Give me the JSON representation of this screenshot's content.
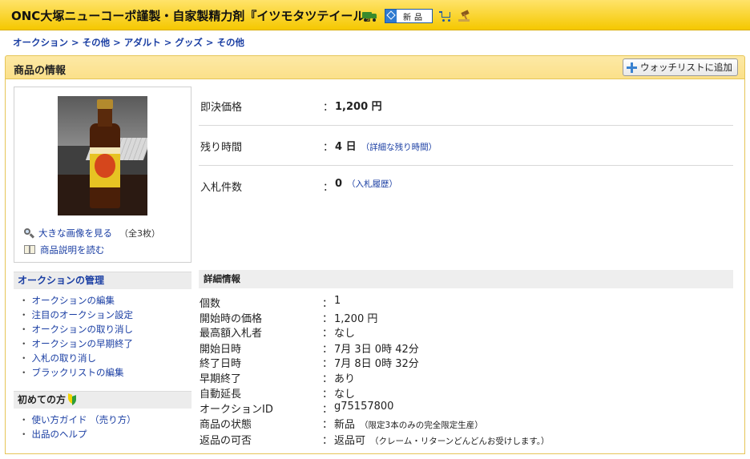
{
  "header": {
    "title": "ONC大塚ニューコーポ謹製・自家製精力剤『イツモタツテイール』",
    "new_badge": "新品"
  },
  "breadcrumb": [
    "オークション",
    "その他",
    "アダルト",
    "グッズ",
    "その他"
  ],
  "section": {
    "title": "商品の情報",
    "watch_button": "ウォッチリストに追加"
  },
  "image_box": {
    "view_large": "大きな画像を見る",
    "count": "（全3枚）",
    "read_description": "商品説明を読む"
  },
  "price_table": {
    "buyout_label": "即決価格",
    "buyout_value": "1,200 円",
    "remaining_label": "残り時間",
    "remaining_value": "4 日",
    "remaining_detail": "（詳細な残り時間）",
    "bids_label": "入札件数",
    "bids_value": "0",
    "bids_history": "（入札履歴）"
  },
  "auction_menu": {
    "title": "オークションの管理",
    "items": [
      "オークションの編集",
      "注目のオークション設定",
      "オークションの取り消し",
      "オークションの早期終了",
      "入札の取り消し",
      "ブラックリストの編集"
    ]
  },
  "beginner_menu": {
    "title": "初めての方",
    "items": [
      "使い方ガイド （売り方）",
      "出品のヘルプ"
    ]
  },
  "details": {
    "title": "詳細情報",
    "rows": [
      {
        "label": "個数",
        "value": "1",
        "note": ""
      },
      {
        "label": "開始時の価格",
        "value": "1,200 円",
        "note": ""
      },
      {
        "label": "最高額入札者",
        "value": "なし",
        "note": ""
      },
      {
        "label": "開始日時",
        "value": "7月 3日 0時 42分",
        "note": ""
      },
      {
        "label": "終了日時",
        "value": "7月 8日 0時 32分",
        "note": ""
      },
      {
        "label": "早期終了",
        "value": "あり",
        "note": ""
      },
      {
        "label": "自動延長",
        "value": "なし",
        "note": ""
      },
      {
        "label": "オークションID",
        "value": "g75157800",
        "note": ""
      },
      {
        "label": "商品の状態",
        "value": "新品",
        "note": "（限定3本のみの完全限定生産）"
      },
      {
        "label": "返品の可否",
        "value": "返品可",
        "note": "（クレーム・リターンどんどんお受けします。）"
      }
    ]
  },
  "colors": {
    "header_bar": "#f5c800",
    "section_bar": "#fbe08a",
    "link": "#1a3ea3"
  }
}
